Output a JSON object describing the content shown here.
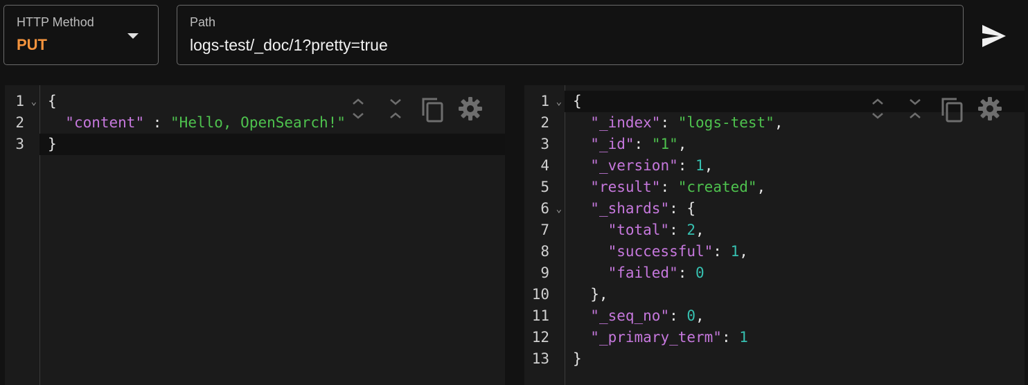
{
  "method": {
    "label": "HTTP Method",
    "value": "PUT"
  },
  "path": {
    "label": "Path",
    "value": "logs-test/_doc/1?pretty=true"
  },
  "icons": {
    "dropdown": "caret-down-icon",
    "send": "send-icon",
    "expand": "expand-all-icon",
    "collapse": "collapse-all-icon",
    "copy": "copy-icon",
    "settings": "gear-icon"
  },
  "colors": {
    "method": "#f5943d",
    "key": "#c678dd",
    "string": "#4ec24e",
    "number": "#36c0b0"
  },
  "request_editor": {
    "active_line": 3,
    "foldable_lines": [
      1
    ],
    "lines": [
      [
        {
          "t": "p",
          "v": "{"
        }
      ],
      [
        {
          "t": "p",
          "v": "  "
        },
        {
          "t": "k",
          "v": "\"content\""
        },
        {
          "t": "p",
          "v": " : "
        },
        {
          "t": "s",
          "v": "\"Hello, OpenSearch!\""
        }
      ],
      [
        {
          "t": "p",
          "v": "}"
        }
      ]
    ]
  },
  "response_editor": {
    "active_line": 1,
    "foldable_lines": [
      1,
      6
    ],
    "lines": [
      [
        {
          "t": "p",
          "v": "{"
        }
      ],
      [
        {
          "t": "p",
          "v": "  "
        },
        {
          "t": "k",
          "v": "\"_index\""
        },
        {
          "t": "p",
          "v": ": "
        },
        {
          "t": "s",
          "v": "\"logs-test\""
        },
        {
          "t": "p",
          "v": ","
        }
      ],
      [
        {
          "t": "p",
          "v": "  "
        },
        {
          "t": "k",
          "v": "\"_id\""
        },
        {
          "t": "p",
          "v": ": "
        },
        {
          "t": "s",
          "v": "\"1\""
        },
        {
          "t": "p",
          "v": ","
        }
      ],
      [
        {
          "t": "p",
          "v": "  "
        },
        {
          "t": "k",
          "v": "\"_version\""
        },
        {
          "t": "p",
          "v": ": "
        },
        {
          "t": "n",
          "v": "1"
        },
        {
          "t": "p",
          "v": ","
        }
      ],
      [
        {
          "t": "p",
          "v": "  "
        },
        {
          "t": "k",
          "v": "\"result\""
        },
        {
          "t": "p",
          "v": ": "
        },
        {
          "t": "s",
          "v": "\"created\""
        },
        {
          "t": "p",
          "v": ","
        }
      ],
      [
        {
          "t": "p",
          "v": "  "
        },
        {
          "t": "k",
          "v": "\"_shards\""
        },
        {
          "t": "p",
          "v": ": {"
        }
      ],
      [
        {
          "t": "p",
          "v": "    "
        },
        {
          "t": "k",
          "v": "\"total\""
        },
        {
          "t": "p",
          "v": ": "
        },
        {
          "t": "n",
          "v": "2"
        },
        {
          "t": "p",
          "v": ","
        }
      ],
      [
        {
          "t": "p",
          "v": "    "
        },
        {
          "t": "k",
          "v": "\"successful\""
        },
        {
          "t": "p",
          "v": ": "
        },
        {
          "t": "n",
          "v": "1"
        },
        {
          "t": "p",
          "v": ","
        }
      ],
      [
        {
          "t": "p",
          "v": "    "
        },
        {
          "t": "k",
          "v": "\"failed\""
        },
        {
          "t": "p",
          "v": ": "
        },
        {
          "t": "n",
          "v": "0"
        }
      ],
      [
        {
          "t": "p",
          "v": "  },"
        }
      ],
      [
        {
          "t": "p",
          "v": "  "
        },
        {
          "t": "k",
          "v": "\"_seq_no\""
        },
        {
          "t": "p",
          "v": ": "
        },
        {
          "t": "n",
          "v": "0"
        },
        {
          "t": "p",
          "v": ","
        }
      ],
      [
        {
          "t": "p",
          "v": "  "
        },
        {
          "t": "k",
          "v": "\"_primary_term\""
        },
        {
          "t": "p",
          "v": ": "
        },
        {
          "t": "n",
          "v": "1"
        }
      ],
      [
        {
          "t": "p",
          "v": "}"
        }
      ]
    ]
  }
}
